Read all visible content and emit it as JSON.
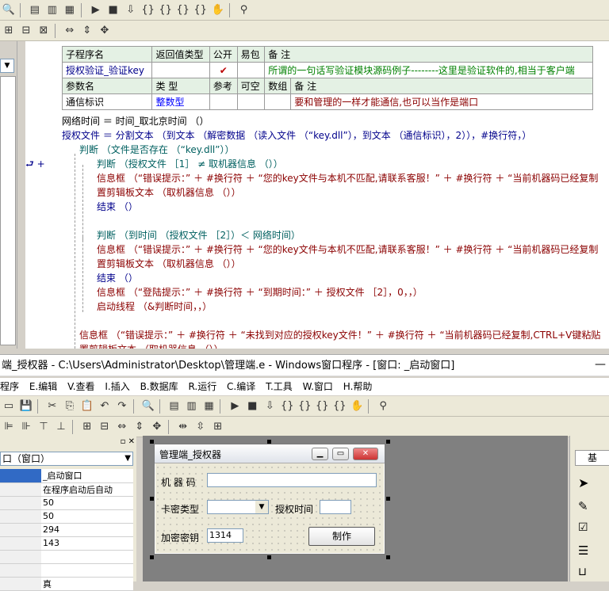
{
  "subroutine_table": {
    "headers": [
      "子程序名",
      "返回值类型",
      "公开",
      "易包",
      "备 注"
    ],
    "row": {
      "name": "授权验证_验证key",
      "return_type": "",
      "public": "✔",
      "easy": "",
      "note": "所谓的一句话写验证模块源码例子--------这里是验证软件的,相当于客户端"
    },
    "param_headers": [
      "参数名",
      "类 型",
      "参考",
      "可空",
      "数组",
      "备 注"
    ],
    "param_row": {
      "name": "通信标识",
      "type": "整数型",
      "ref": "",
      "nullable": "",
      "array": "",
      "note": "要和管理的一样才能通信,也可以当作是端口"
    }
  },
  "code_lines": [
    "网络时间 ＝ 时间_取北京时间 （）",
    "授权文件 ＝ 分割文本 （到文本 （解密数据 （读入文件 （“key.dll”），到文本 （通信标识），2）），#换行符，）",
    "判断 （文件是否存在 （“key.dll”））",
    "判断 （授权文件 ［1］ ≠ 取机器信息 （））",
    "信息框 （“错误提示：” ＋ #换行符 ＋ “您的key文件与本机不匹配,请联系客服！” ＋ #换行符 ＋ “当前机器码已经复制",
    "置剪辑板文本 （取机器信息 （））",
    "结束 （）",
    "判断 （到时间 （授权文件 ［2］）＜ 网络时间）",
    "信息框 （“错误提示：” ＋ #换行符 ＋ “您的key文件与本机不匹配,请联系客服！” ＋ #换行符 ＋ “当前机器码已经复制",
    "置剪辑板文本 （取机器信息 （））",
    "结束 （）",
    "信息框 （“登陆提示：” ＋ #换行符 ＋ “到期时间：” ＋ 授权文件 ［2］，0，，）",
    "启动线程 （&判断时间，，）",
    "信息框 （“错误提示：” ＋ #换行符 ＋ “未找到对应的授权key文件！” ＋ #换行符 ＋ “当前机器码已经复制,CTRL+V键粘贴",
    "置剪辑板文本 （取机器信息 （））"
  ],
  "gutter_marker": "⮐ +",
  "window_title": "端_授权器 - C:\\Users\\Administrator\\Desktop\\管理端.e - Windows窗口程序 - [窗口: _启动窗口]",
  "menu": [
    "程序",
    "E.编辑",
    "V.查看",
    "I.插入",
    "B.数据库",
    "R.运行",
    "C.编译",
    "T.工具",
    "W.窗口",
    "H.帮助"
  ],
  "left_panel": {
    "selector": "口（窗口）",
    "rows": [
      "_启动窗口",
      "在程序启动后自动",
      "50",
      "50",
      "294",
      "143",
      "",
      "",
      "真",
      ""
    ]
  },
  "form": {
    "title": "管理端_授权器",
    "machine_code_label": "机 器 码",
    "machine_code_value": "",
    "card_type_label": "卡密类型",
    "auth_time_label": "授权时间",
    "encrypt_key_label": "加密密钥",
    "encrypt_key_value": "1314",
    "make_button": "制作"
  },
  "right_panel": {
    "header": "基"
  }
}
